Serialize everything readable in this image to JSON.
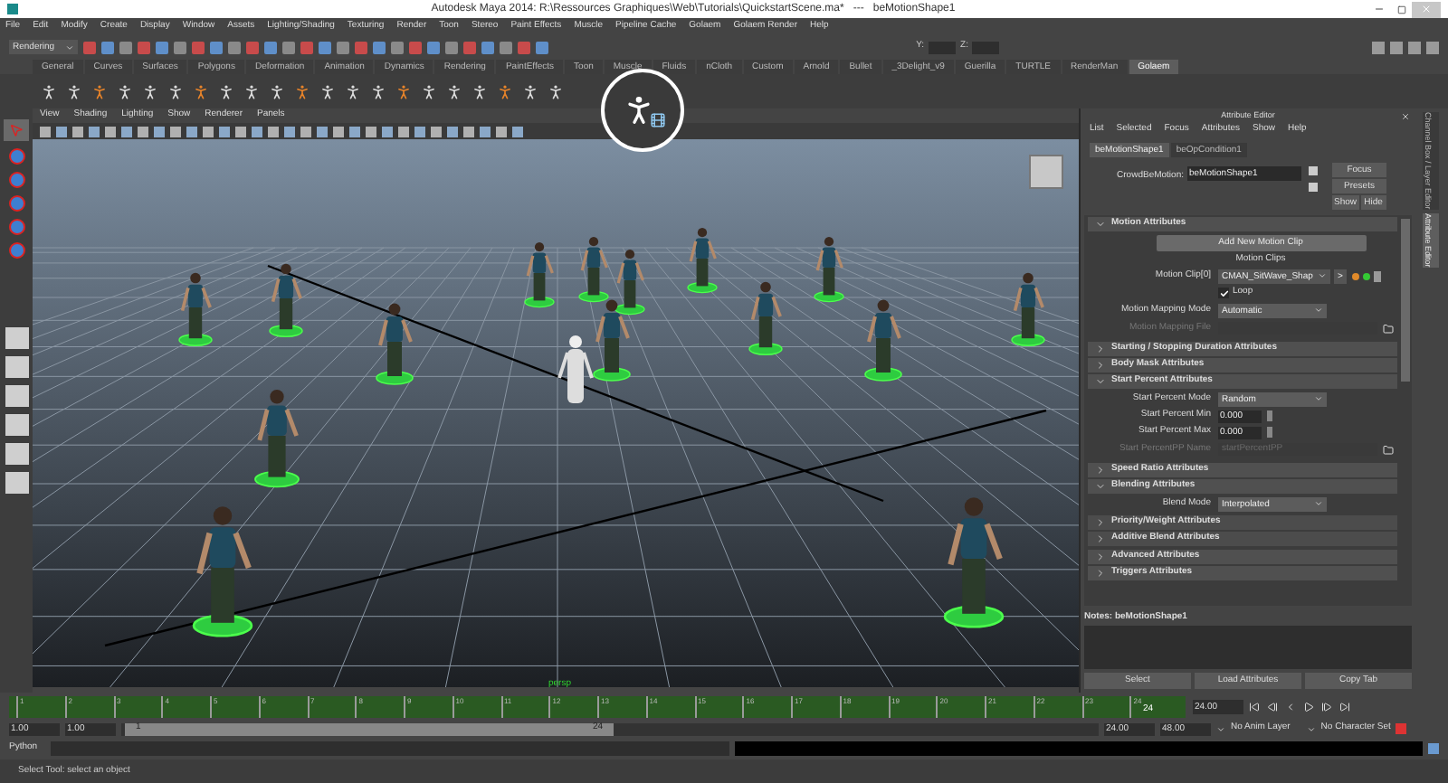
{
  "window": {
    "title": "Autodesk Maya 2014: R:\\Ressources Graphiques\\Web\\Tutorials\\QuickstartScene.ma*   ---   beMotionShape1"
  },
  "menu": [
    "File",
    "Edit",
    "Modify",
    "Create",
    "Display",
    "Window",
    "Assets",
    "Lighting/Shading",
    "Texturing",
    "Render",
    "Toon",
    "Stereo",
    "Paint Effects",
    "Muscle",
    "Pipeline Cache",
    "Golaem",
    "Golaem Render",
    "Help"
  ],
  "status_line": {
    "mode": "Rendering",
    "fields": [
      "Y:",
      "Z:"
    ]
  },
  "shelf_tabs": [
    {
      "label": "General",
      "selected": false
    },
    {
      "label": "Curves",
      "selected": false
    },
    {
      "label": "Surfaces",
      "selected": false
    },
    {
      "label": "Polygons",
      "selected": false
    },
    {
      "label": "Deformation",
      "selected": false
    },
    {
      "label": "Animation",
      "selected": false
    },
    {
      "label": "Dynamics",
      "selected": false
    },
    {
      "label": "Rendering",
      "selected": false
    },
    {
      "label": "PaintEffects",
      "selected": false
    },
    {
      "label": "Toon",
      "selected": false
    },
    {
      "label": "Muscle",
      "selected": false
    },
    {
      "label": "Fluids",
      "selected": false
    },
    {
      "label": "nCloth",
      "selected": false
    },
    {
      "label": "Custom",
      "selected": false
    },
    {
      "label": "Arnold",
      "selected": false
    },
    {
      "label": "Bullet",
      "selected": false
    },
    {
      "label": "_3Delight_v9",
      "selected": false
    },
    {
      "label": "Guerilla",
      "selected": false
    },
    {
      "label": "TURTLE",
      "selected": false
    },
    {
      "label": "RenderMan",
      "selected": false
    },
    {
      "label": "Golaem",
      "selected": true
    }
  ],
  "viewport": {
    "menu": [
      "View",
      "Shading",
      "Lighting",
      "Show",
      "Renderer",
      "Panels"
    ],
    "camera": "persp"
  },
  "attribute_editor": {
    "title": "Attribute Editor",
    "menu": [
      "List",
      "Selected",
      "Focus",
      "Attributes",
      "Show",
      "Help"
    ],
    "tabs": [
      {
        "label": "beMotionShape1",
        "selected": true
      },
      {
        "label": "beOpCondition1",
        "selected": false
      }
    ],
    "node_label": "CrowdBeMotion:",
    "node_value": "beMotionShape1",
    "buttons": [
      "Focus",
      "Presets",
      "Show",
      "Hide"
    ],
    "sections": [
      {
        "title": "Motion Attributes",
        "expanded": true,
        "rows": [
          {
            "kind": "button",
            "label": "Add New Motion Clip"
          },
          {
            "kind": "heading",
            "label": "Motion Clips"
          },
          {
            "kind": "clip",
            "label": "Motion Clip[0]",
            "value": "CMAN_SitWave_Shap",
            "button": ">"
          },
          {
            "kind": "checkbox",
            "label": "Loop",
            "checked": true
          },
          {
            "kind": "dropdown",
            "label": "Motion Mapping Mode",
            "value": "Automatic",
            "disabled": false
          },
          {
            "kind": "file",
            "label": "Motion Mapping File",
            "disabled": true
          }
        ]
      },
      {
        "title": "Starting / Stopping Duration Attributes",
        "expanded": false
      },
      {
        "title": "Body Mask Attributes",
        "expanded": false
      },
      {
        "title": "Start Percent Attributes",
        "expanded": true,
        "rows": [
          {
            "kind": "dropdown",
            "label": "Start Percent Mode",
            "value": "Random",
            "disabled": false
          },
          {
            "kind": "slider",
            "label": "Start Percent Min",
            "value": "0.000",
            "level": 0
          },
          {
            "kind": "slider",
            "label": "Start Percent Max",
            "value": "0.000",
            "level": 0
          },
          {
            "kind": "file",
            "label": "Start PercentPP Name",
            "placeholder": "startPercentPP",
            "disabled": true
          }
        ]
      },
      {
        "title": "Speed Ratio Attributes",
        "expanded": false
      },
      {
        "title": "Blending Attributes",
        "expanded": true,
        "rows": [
          {
            "kind": "dropdown",
            "label": "Blend Mode",
            "value": "Interpolated",
            "disabled": false
          }
        ],
        "children": [
          {
            "title": "Priority/Weight Attributes",
            "expanded": false
          },
          {
            "title": "Additive Blend Attributes",
            "expanded": false
          }
        ]
      },
      {
        "title": "Advanced Attributes",
        "expanded": false
      },
      {
        "title": "Triggers Attributes",
        "expanded": false
      }
    ],
    "notes": "Notes:  beMotionShape1",
    "bottom_buttons": [
      "Select",
      "Load Attributes",
      "Copy Tab"
    ]
  },
  "side_tabs": [
    {
      "label": "Channel Box / Layer Editor",
      "selected": false
    },
    {
      "label": "Attribute Editor",
      "selected": true
    }
  ],
  "timeline": {
    "ticks": [
      "1",
      "2",
      "3",
      "4",
      "5",
      "6",
      "7",
      "8",
      "9",
      "10",
      "11",
      "12",
      "13",
      "14",
      "15",
      "16",
      "17",
      "18",
      "19",
      "20",
      "21",
      "22",
      "23",
      "24"
    ],
    "current": "24",
    "current_field": "24.00",
    "level": 1
  },
  "range": {
    "start": "1.00",
    "playback_start": "1.00",
    "level": 0.5,
    "slider_start": "1",
    "slider_end": "24",
    "playback_end": "24.00",
    "end": "48.00",
    "anim_layer": "No Anim Layer",
    "character_set": "No Character Set"
  },
  "command_line": {
    "label": "Python"
  },
  "help_line": "Select Tool: select an object"
}
